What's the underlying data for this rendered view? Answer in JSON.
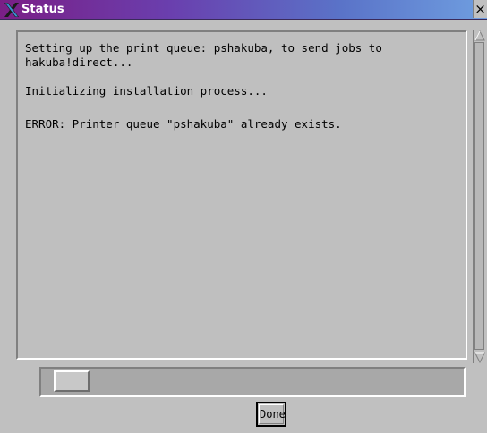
{
  "window": {
    "title": "Status",
    "close_label": "×"
  },
  "messages": [
    "Setting up the print queue: pshakuba, to send jobs to",
    "hakuba!direct...",
    "Initializing installation process...",
    "ERROR: Printer queue \"pshakuba\" already exists."
  ],
  "buttons": {
    "done": "Done"
  },
  "colors": {
    "title_gradient_start": "#7a1f86",
    "title_gradient_end": "#6f9ee0",
    "background": "#c0c0c0"
  },
  "icons": {
    "window_icon": "x-logo-icon",
    "close": "close-icon"
  }
}
